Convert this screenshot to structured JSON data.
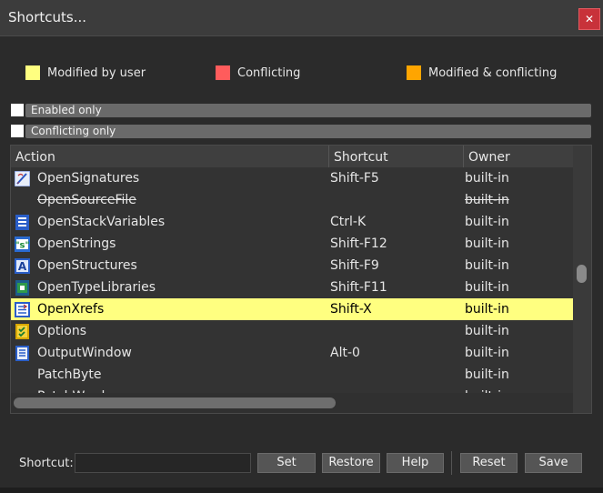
{
  "window": {
    "title": "Shortcuts...",
    "close_glyph": "✕"
  },
  "legend": [
    {
      "label": "Modified by user",
      "color": "#ffff80"
    },
    {
      "label": "Conflicting",
      "color": "#ff5c5c"
    },
    {
      "label": "Modified & conflicting",
      "color": "#ffa500"
    }
  ],
  "filters": [
    {
      "label": "Enabled only",
      "checked": false
    },
    {
      "label": "Conflicting only",
      "checked": false
    }
  ],
  "table": {
    "columns": [
      "Action",
      "Shortcut",
      "Owner"
    ],
    "rows": [
      {
        "icon": "signatures-icon",
        "action": "OpenSignatures",
        "shortcut": "Shift-F5",
        "owner": "built-in",
        "disabled": false
      },
      {
        "icon": "",
        "action": "OpenSourceFile",
        "shortcut": "",
        "owner": "built-in",
        "disabled": true
      },
      {
        "icon": "stack-variables-icon",
        "action": "OpenStackVariables",
        "shortcut": "Ctrl-K",
        "owner": "built-in",
        "disabled": false
      },
      {
        "icon": "strings-icon",
        "action": "OpenStrings",
        "shortcut": "Shift-F12",
        "owner": "built-in",
        "disabled": false
      },
      {
        "icon": "structures-icon",
        "action": "OpenStructures",
        "shortcut": "Shift-F9",
        "owner": "built-in",
        "disabled": false
      },
      {
        "icon": "type-libraries-icon",
        "action": "OpenTypeLibraries",
        "shortcut": "Shift-F11",
        "owner": "built-in",
        "disabled": false
      },
      {
        "icon": "xrefs-icon",
        "action": "OpenXrefs",
        "shortcut": "Shift-X",
        "owner": "built-in",
        "disabled": false,
        "selected": true
      },
      {
        "icon": "options-icon",
        "action": "Options",
        "shortcut": "",
        "owner": "built-in",
        "disabled": false
      },
      {
        "icon": "output-window-icon",
        "action": "OutputWindow",
        "shortcut": "Alt-0",
        "owner": "built-in",
        "disabled": false
      },
      {
        "icon": "",
        "action": "PatchByte",
        "shortcut": "",
        "owner": "built-in",
        "disabled": false
      },
      {
        "icon": "",
        "action": "PatchWord",
        "shortcut": "",
        "owner": "built-in",
        "disabled": false
      }
    ]
  },
  "bottom": {
    "shortcut_label": "Shortcut:",
    "shortcut_value": "",
    "buttons": {
      "set": "Set",
      "restore": "Restore",
      "help": "Help",
      "reset": "Reset",
      "save": "Save"
    }
  }
}
